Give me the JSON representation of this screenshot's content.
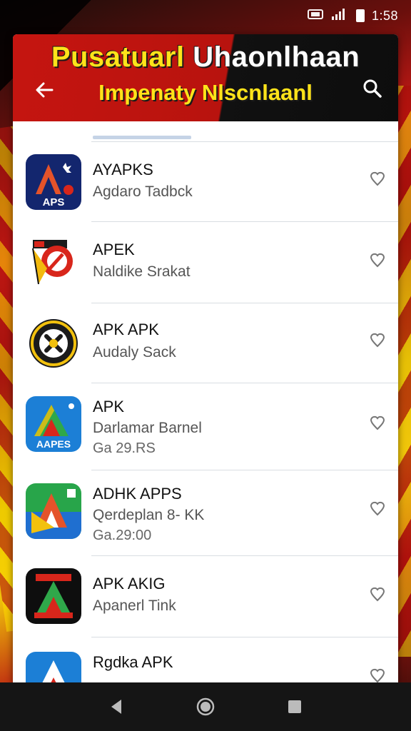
{
  "status_bar": {
    "time": "1:58"
  },
  "header": {
    "title_part1": "Pusatuarl",
    "title_part2": "Uhaonlhaan",
    "subtitle": "Impenaty Nlscnlaanl"
  },
  "apps": [
    {
      "name": "AYAPKS",
      "desc": "Agdaro Tadbck",
      "meta": "",
      "icon_label": "APS"
    },
    {
      "name": "APEK",
      "desc": "Naldike Srakat",
      "meta": "",
      "icon_label": ""
    },
    {
      "name": "APK APK",
      "desc": "Audaly Sack",
      "meta": "",
      "icon_label": ""
    },
    {
      "name": "APK",
      "desc": "Darlamar Barnel",
      "meta": "Ga 29.RS",
      "icon_label": "AAPES"
    },
    {
      "name": "ADHK APPS",
      "desc": "Qerdeplan 8- KK",
      "meta": "Ga.29:00",
      "icon_label": ""
    },
    {
      "name": "APK AKIG",
      "desc": "Apanerl Tink",
      "meta": "",
      "icon_label": ""
    },
    {
      "name": "Rgdka APK",
      "desc": "",
      "meta": "",
      "icon_label": ""
    }
  ],
  "colors": {
    "header_red": "#c51510",
    "title_yellow": "#ffe31a",
    "nav_bg": "#151515"
  }
}
